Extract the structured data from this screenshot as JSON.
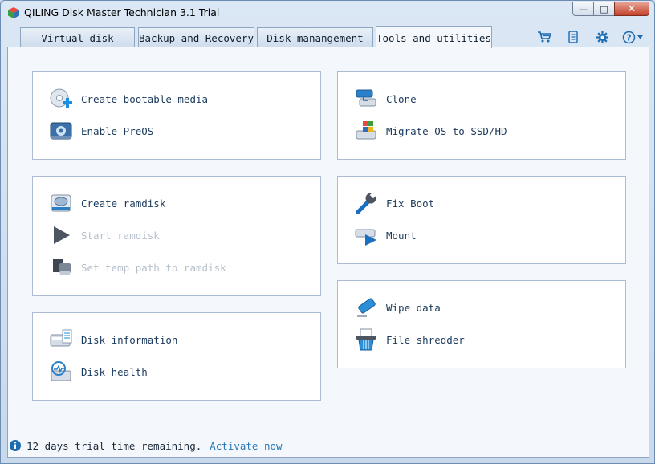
{
  "window": {
    "title": "QILING Disk Master Technician 3.1 Trial"
  },
  "window_buttons": {
    "minimize": "—",
    "maximize": "□",
    "close": "✕"
  },
  "tabs": [
    {
      "label": "Virtual disk"
    },
    {
      "label": "Backup and Recovery"
    },
    {
      "label": "Disk manangement"
    },
    {
      "label": "Tools and utilities"
    }
  ],
  "active_tab": "Tools and utilities",
  "toolbar_icons": [
    "cart-icon",
    "document-icon",
    "gear-icon",
    "help-icon"
  ],
  "groups": {
    "boot": [
      {
        "label": "Create bootable media",
        "icon": "bootable-media-icon",
        "enabled": true
      },
      {
        "label": "Enable PreOS",
        "icon": "preos-icon",
        "enabled": true
      }
    ],
    "ramdisk": [
      {
        "label": "Create ramdisk",
        "icon": "ramdisk-icon",
        "enabled": true
      },
      {
        "label": "Start ramdisk",
        "icon": "play-icon",
        "enabled": false
      },
      {
        "label": "Set temp path to ramdisk",
        "icon": "temp-path-icon",
        "enabled": false
      }
    ],
    "disk_info": [
      {
        "label": "Disk information",
        "icon": "disk-info-icon",
        "enabled": true
      },
      {
        "label": "Disk health",
        "icon": "disk-health-icon",
        "enabled": true
      }
    ],
    "clone": [
      {
        "label": "Clone",
        "icon": "clone-icon",
        "enabled": true
      },
      {
        "label": "Migrate OS to SSD/HD",
        "icon": "migrate-os-icon",
        "enabled": true
      }
    ],
    "repair": [
      {
        "label": "Fix Boot",
        "icon": "wrench-icon",
        "enabled": true
      },
      {
        "label": "Mount",
        "icon": "mount-icon",
        "enabled": true
      }
    ],
    "wipe": [
      {
        "label": "Wipe data",
        "icon": "eraser-icon",
        "enabled": true
      },
      {
        "label": "File shredder",
        "icon": "shredder-icon",
        "enabled": true
      }
    ]
  },
  "status": {
    "text": "12 days trial time remaining.",
    "link": "Activate now"
  },
  "colors": {
    "accent": "#2a7ab8",
    "disabled": "#b5bfcb",
    "link": "#2a7ab8"
  }
}
